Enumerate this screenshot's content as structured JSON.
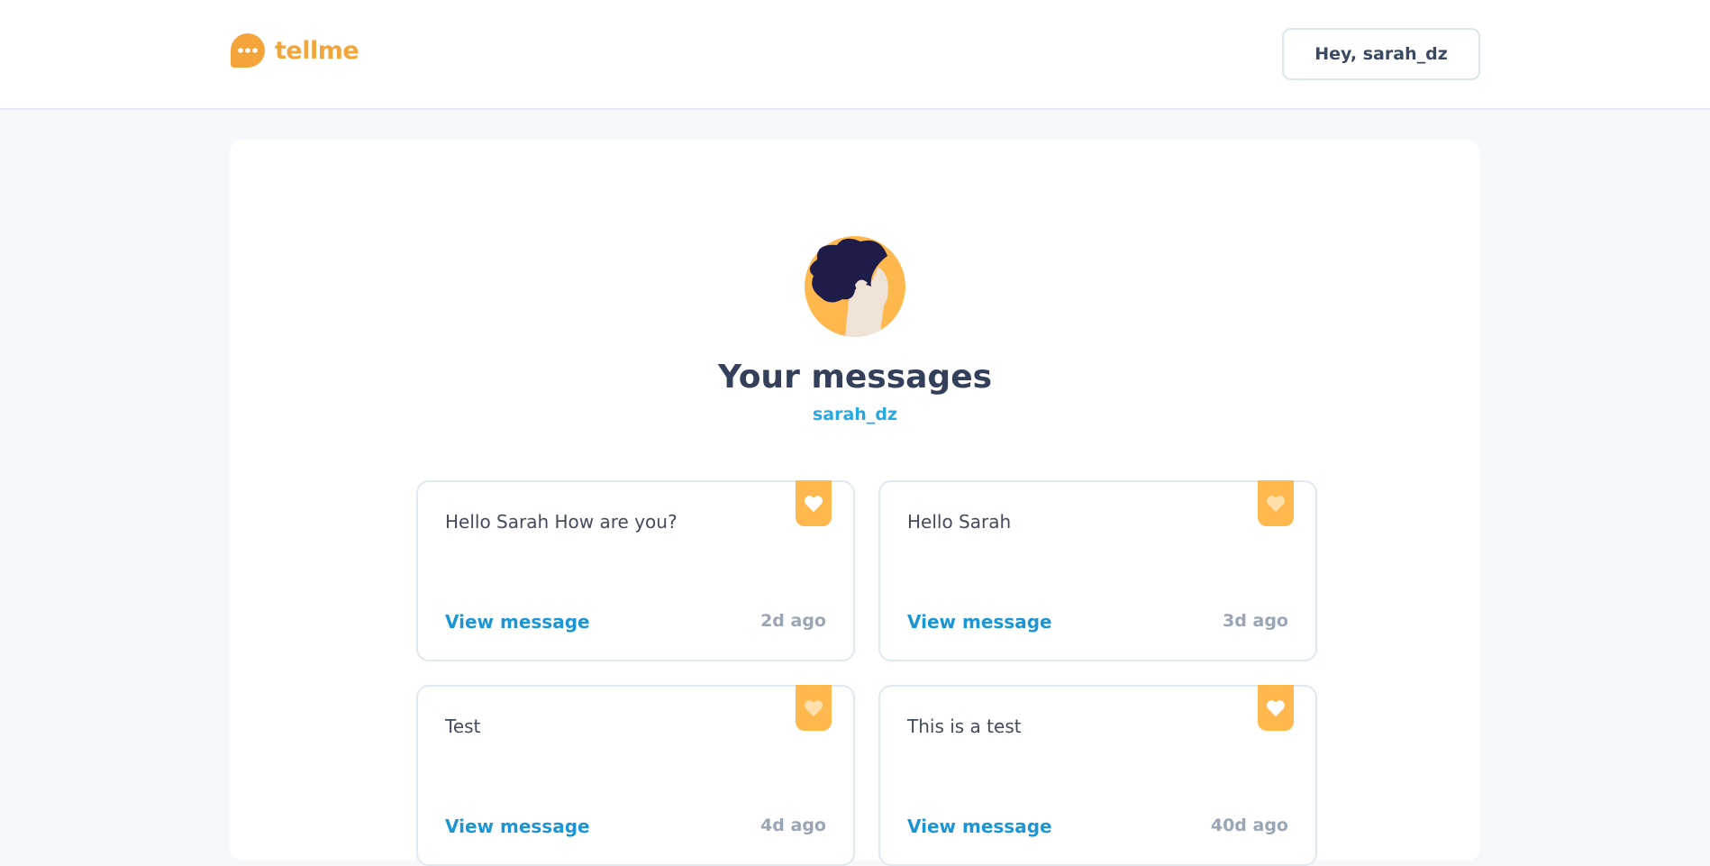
{
  "brand": {
    "name": "tellme",
    "color": "#f0a63a"
  },
  "header": {
    "greeting": "Hey, sarah_dz"
  },
  "page": {
    "title": "Your messages",
    "username": "sarah_dz"
  },
  "messages": [
    {
      "text": "Hello Sarah How are you?",
      "link": "View message",
      "time": "2d ago",
      "liked": true
    },
    {
      "text": "Hello Sarah",
      "link": "View message",
      "time": "3d ago",
      "liked": false
    },
    {
      "text": "Test",
      "link": "View message",
      "time": "4d ago",
      "liked": false
    },
    {
      "text": "This is a test",
      "link": "View message",
      "time": "40d ago",
      "liked": true
    }
  ],
  "icons": {
    "logo": "chat-bubble-icon",
    "avatar": "user-avatar",
    "like": "heart-icon"
  },
  "colors": {
    "accent": "#ffb84d",
    "link": "#1b95d4",
    "username": "#27a8e0"
  }
}
